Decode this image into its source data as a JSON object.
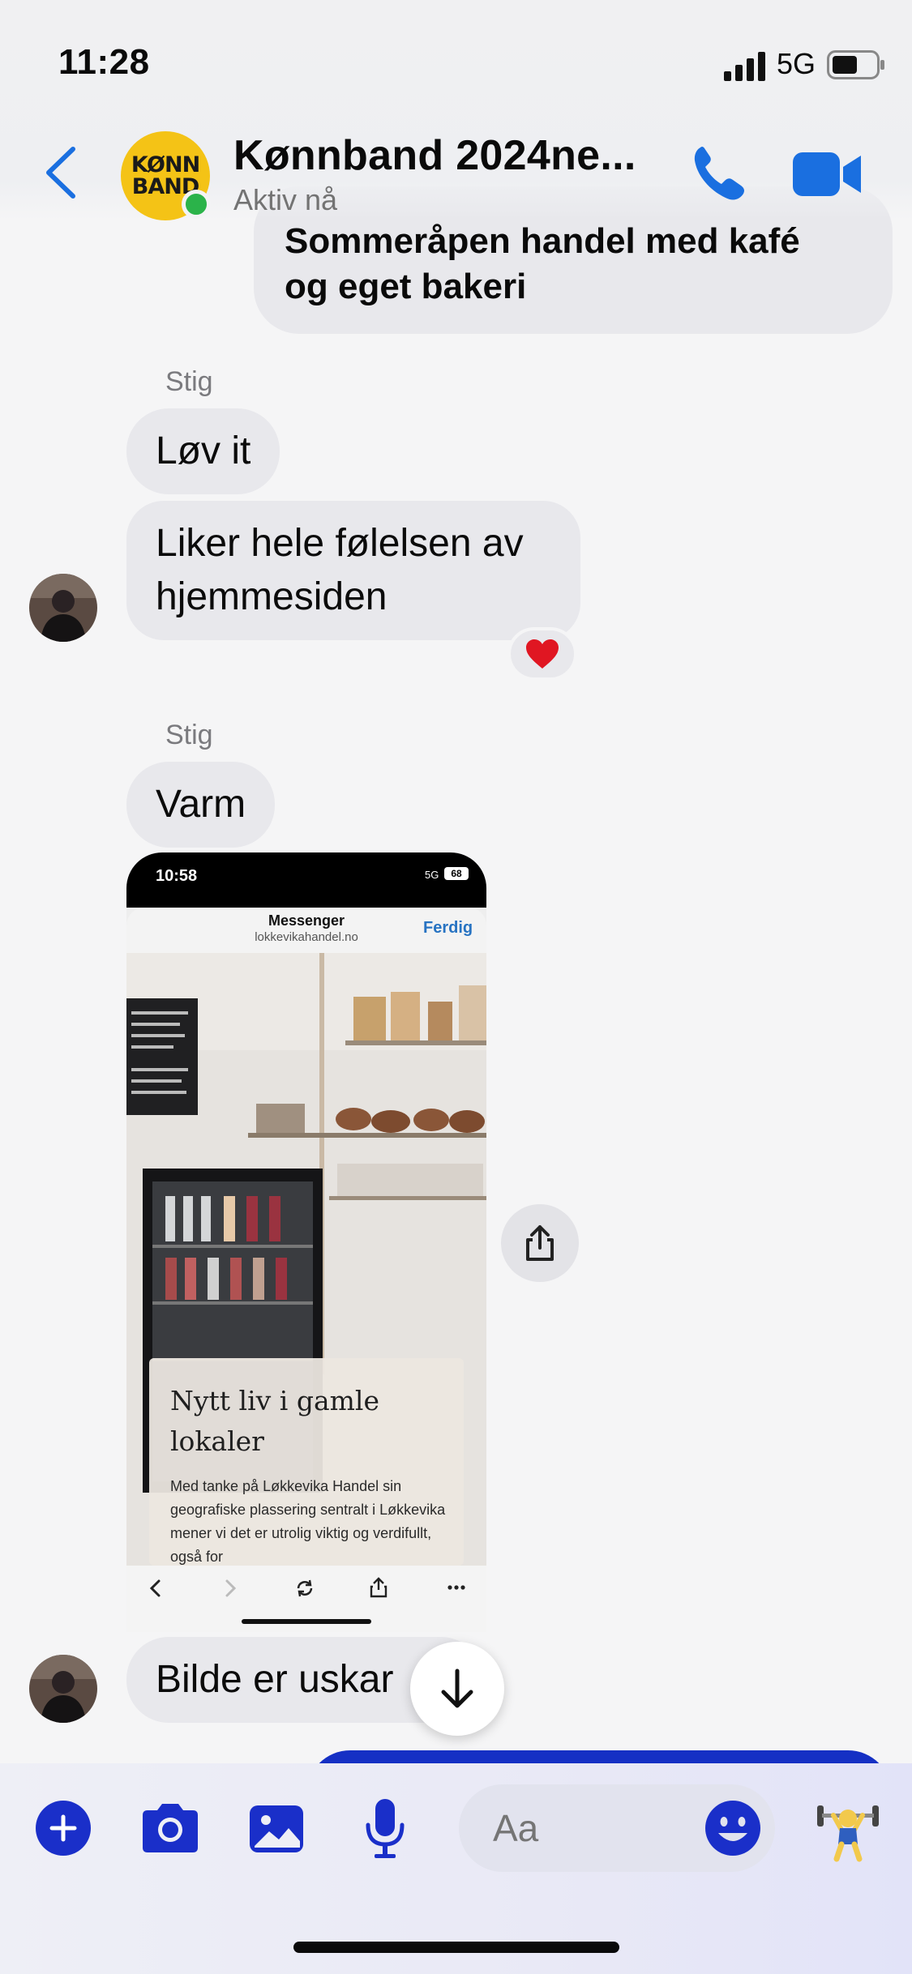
{
  "status_bar": {
    "time": "11:28",
    "network": "5G"
  },
  "header": {
    "title": "Kønnband 2024ne...",
    "status": "Aktiv nå",
    "avatar_text_1": "KØNN",
    "avatar_text_2": "BAND"
  },
  "messages": {
    "outgoing_top": {
      "line1": "Sommeråpen handel med kafé",
      "line2": "og eget bakeri"
    },
    "sender_1": "Stig",
    "msg_1": "Løv it",
    "msg_2": "Liker hele følelsen av hjemmesiden",
    "reaction": "❤️",
    "sender_2": "Stig",
    "msg_3": "Varm",
    "msg_4": "Bilde er uskar"
  },
  "attachment": {
    "time": "10:58",
    "network": "5G",
    "battery": "68",
    "app": "Messenger",
    "url": "lokkevikahandel.no",
    "done": "Ferdig",
    "headline": "Nytt liv i gamle lokaler",
    "body": "Med tanke på Løkkevika Handel sin geografiske plassering sentralt i Løkkevika mener vi det er utrolig viktig og verdifullt, også for"
  },
  "composer": {
    "placeholder": "Aa",
    "quick_reaction": "🏋️"
  },
  "colors": {
    "accent": "#1a2fc9",
    "bubble": "#e8e8ec",
    "online": "#2bb34a",
    "outgoing": "#1530c4"
  }
}
